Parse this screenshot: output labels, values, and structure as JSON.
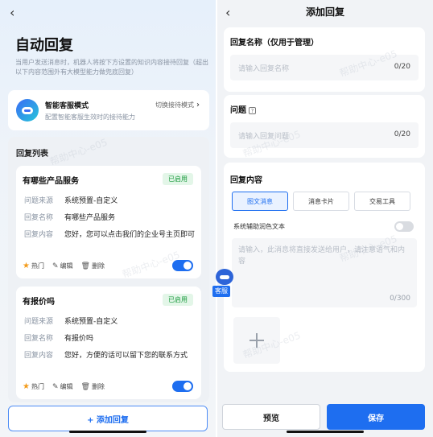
{
  "left": {
    "title": "自动回复",
    "subtitle": "当用户发送消息时，机器人将按下方设置的知识内容接待回复（超出以下内容范围外有大模型能力做兜底回复）",
    "mode": {
      "title": "智能客服模式",
      "desc": "配置智能客服生效时的接待能力",
      "switch_label": "切换接待模式"
    },
    "list_title": "回复列表",
    "items": [
      {
        "name": "有哪些产品服务",
        "status": "已启用",
        "rows": [
          {
            "k": "问题来源",
            "v": "系统预置-自定义"
          },
          {
            "k": "回复名称",
            "v": "有哪些产品服务"
          },
          {
            "k": "回复内容",
            "v": "您好，您可以点击我们的企业号主页即可"
          }
        ],
        "hot": "热门",
        "edit": "编辑",
        "delete": "删除"
      },
      {
        "name": "有报价吗",
        "status": "已启用",
        "rows": [
          {
            "k": "问题来源",
            "v": "系统预置-自定义"
          },
          {
            "k": "回复名称",
            "v": "有报价吗"
          },
          {
            "k": "回复内容",
            "v": "您好，方便的话可以留下您的联系方式"
          }
        ],
        "hot": "热门",
        "edit": "编辑",
        "delete": "删除"
      }
    ],
    "add_button": "+ 添加回复",
    "float_label": "客服"
  },
  "right": {
    "title": "添加回复",
    "name_label": "回复名称（仅用于管理）",
    "name_placeholder": "请输入回复名称",
    "name_count": "0/20",
    "question_label": "问题",
    "question_placeholder": "请输入回复问题",
    "question_count": "0/20",
    "content_label": "回复内容",
    "tabs": [
      "图文消息",
      "消息卡片",
      "交易工具"
    ],
    "ai_label": "系统辅助润色文本",
    "content_placeholder": "请输入，此消息将直接发送给用户，请注意语气和内容",
    "content_count": "0/300",
    "preview": "预览",
    "save": "保存"
  },
  "watermark": "帮助中心-e05"
}
